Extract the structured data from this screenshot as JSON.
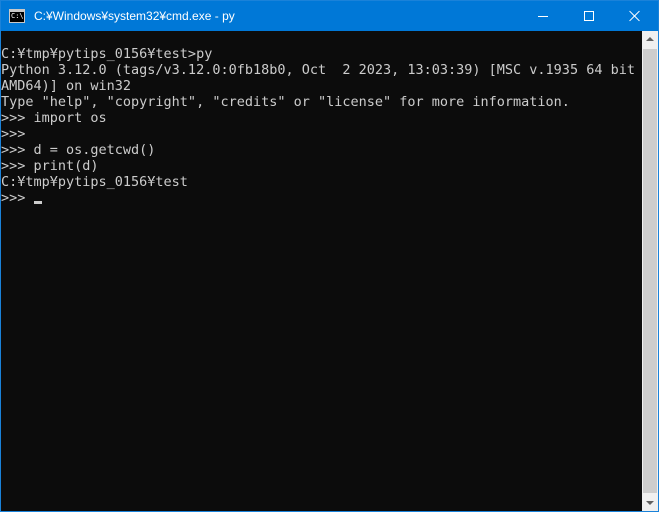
{
  "window": {
    "title": "C:¥Windows¥system32¥cmd.exe - py",
    "icon": "cmd-icon",
    "icon_glyph": "C:\\",
    "controls": {
      "minimize": "minimize-icon",
      "maximize": "maximize-icon",
      "close": "close-icon"
    }
  },
  "console": {
    "lines": [
      "C:¥tmp¥pytips_0156¥test>py",
      "Python 3.12.0 (tags/v3.12.0:0fb18b0, Oct  2 2023, 13:03:39) [MSC v.1935 64 bit (",
      "AMD64)] on win32",
      "Type \"help\", \"copyright\", \"credits\" or \"license\" for more information.",
      ">>> import os",
      ">>>",
      ">>> d = os.getcwd()",
      ">>> print(d)",
      "C:¥tmp¥pytips_0156¥test",
      ">>> "
    ]
  },
  "colors": {
    "titlebar": "#0078d7",
    "console_bg": "#0c0c0c",
    "console_fg": "#cccccc"
  }
}
